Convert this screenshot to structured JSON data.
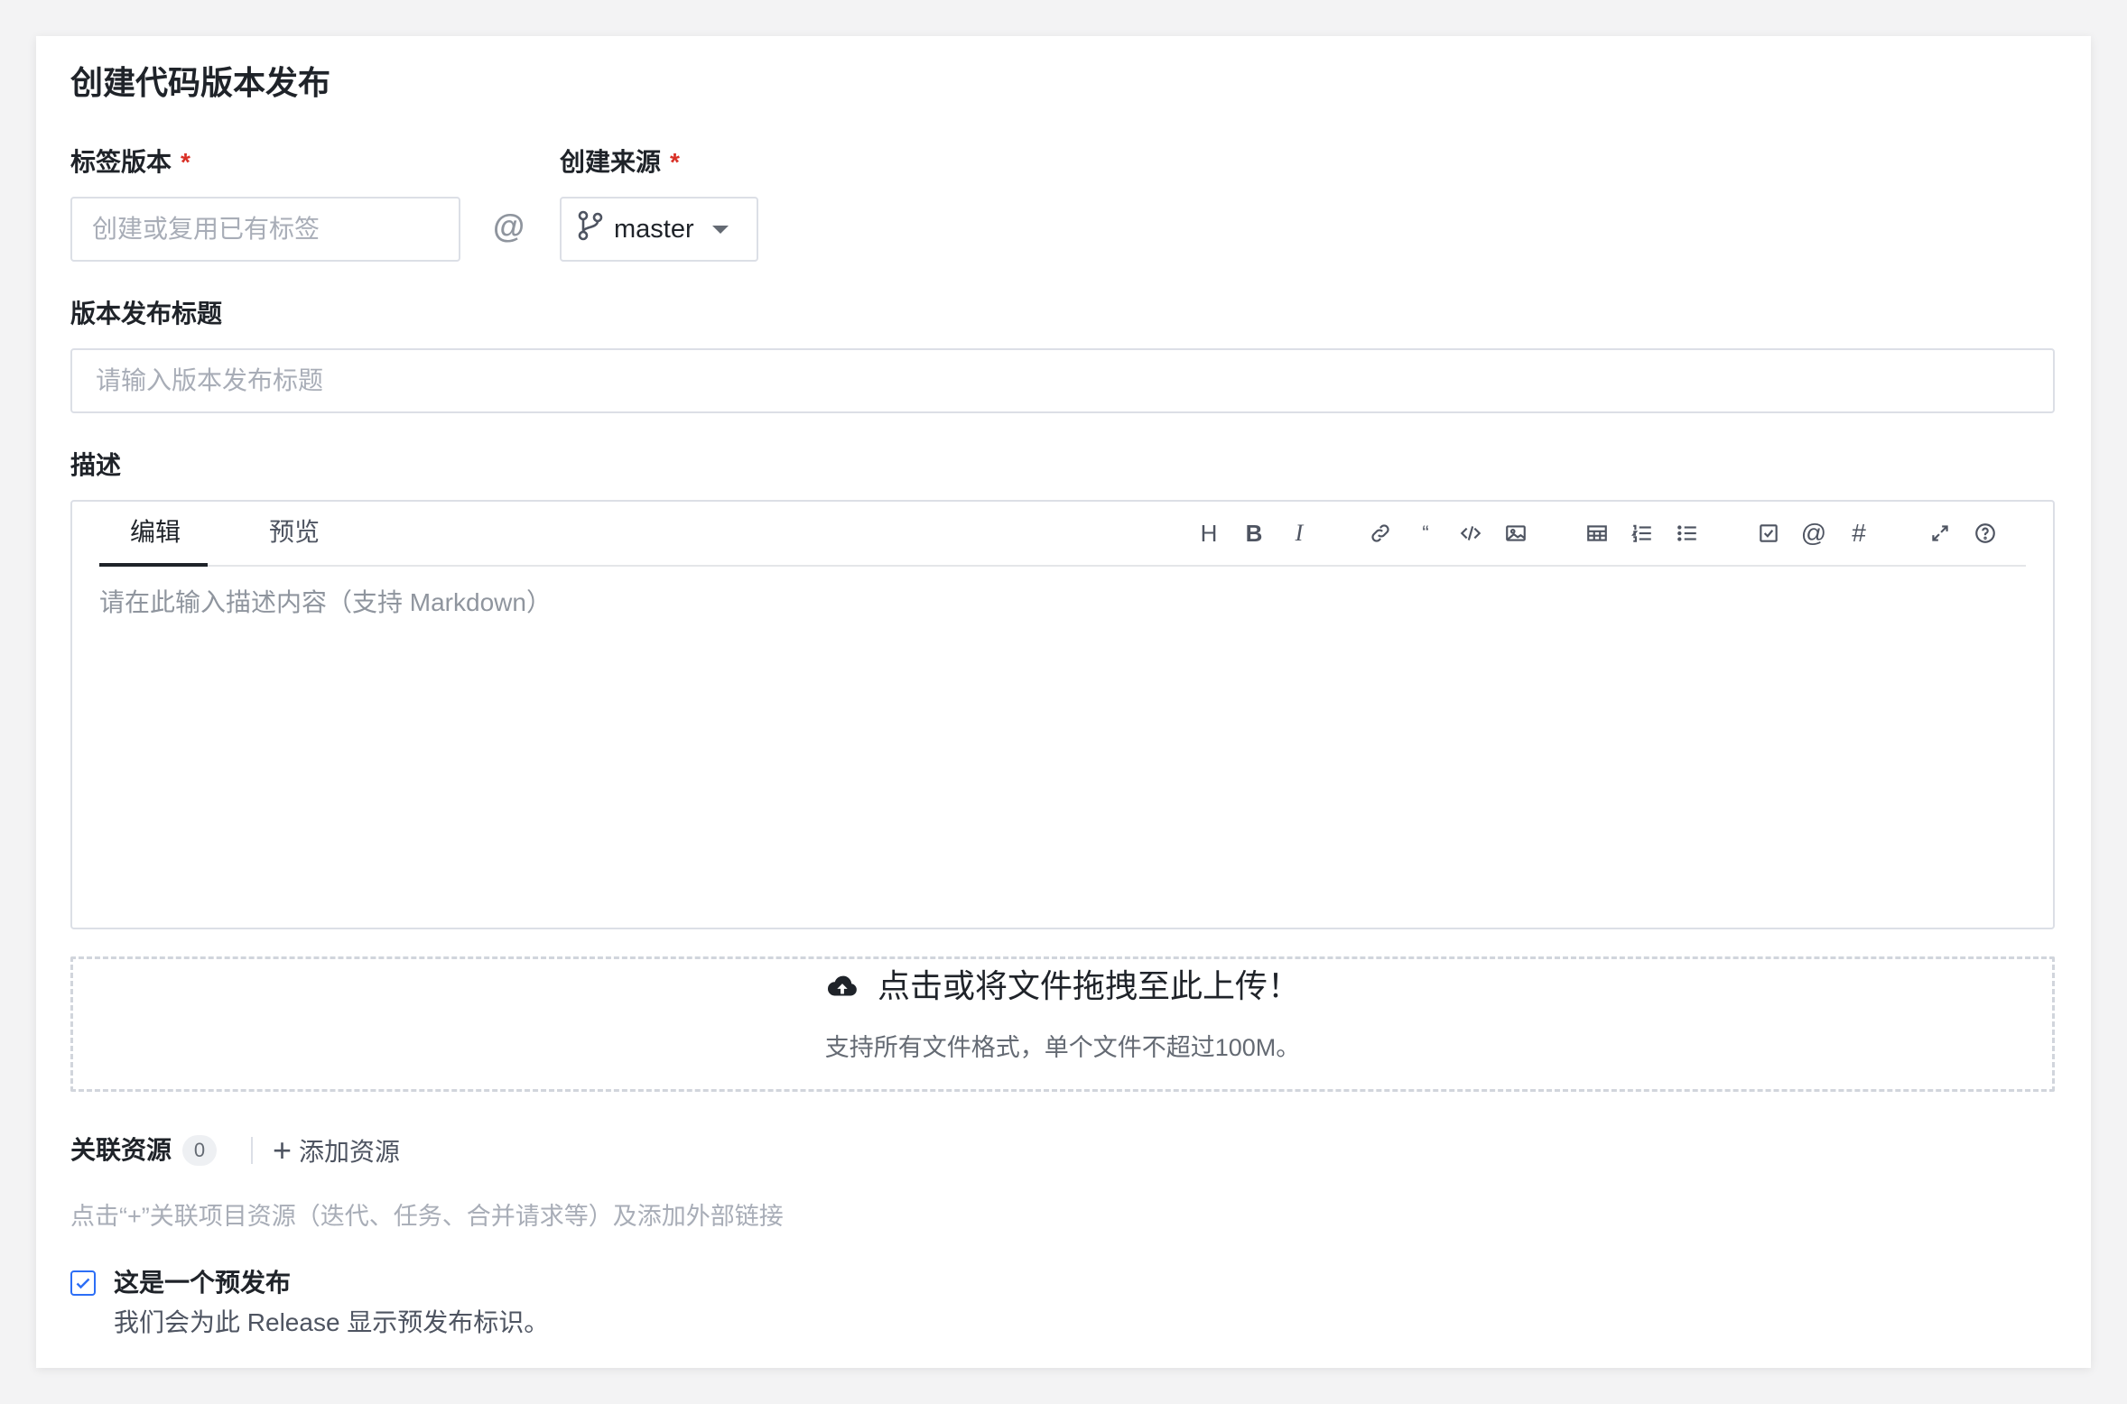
{
  "page": {
    "title": "创建代码版本发布"
  },
  "tag_field": {
    "label": "标签版本",
    "required_mark": "*",
    "placeholder": "创建或复用已有标签"
  },
  "separator": "@",
  "source_field": {
    "label": "创建来源",
    "required_mark": "*",
    "selected_branch": "master"
  },
  "title_field": {
    "label": "版本发布标题",
    "placeholder": "请输入版本发布标题"
  },
  "description": {
    "label": "描述",
    "tabs": [
      {
        "label": "编辑",
        "active": true
      },
      {
        "label": "预览",
        "active": false
      }
    ],
    "toolbar": {
      "heading": "H",
      "bold": "B",
      "italic": "I",
      "quote": "“",
      "mention": "@",
      "hash": "#"
    },
    "placeholder": "请在此输入描述内容（支持 Markdown）"
  },
  "upload": {
    "main_text": "点击或将文件拖拽至此上传！",
    "sub_text": "支持所有文件格式，单个文件不超过100M。"
  },
  "resources": {
    "label": "关联资源",
    "count": "0",
    "add_label": "添加资源",
    "add_symbol": "+",
    "hint": "点击“+”关联项目资源（迭代、任务、合并请求等）及添加外部链接"
  },
  "prerelease": {
    "checked": true,
    "label": "这是一个预发布",
    "description": "我们会为此 Release 显示预发布标识。"
  },
  "colors": {
    "accent": "#2c6ef6",
    "required": "#d93026",
    "border": "#dcdfe6",
    "placeholder": "#a8adb7"
  }
}
